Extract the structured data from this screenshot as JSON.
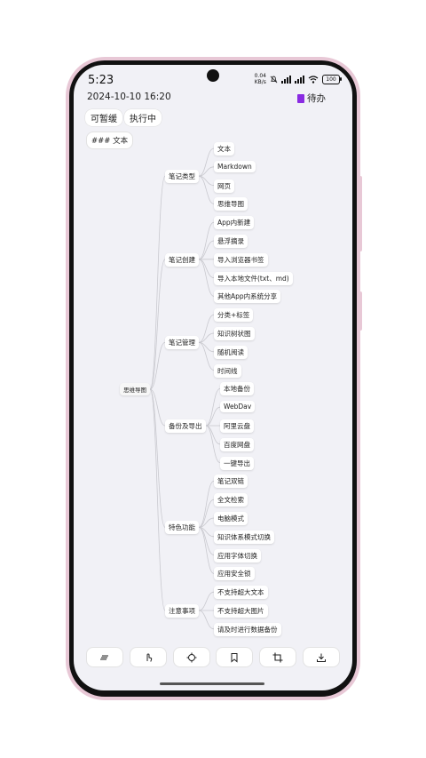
{
  "status": {
    "time": "5:23",
    "speed_value": "0.04",
    "speed_unit": "KB/s",
    "battery": "100"
  },
  "header": {
    "date": "2024-10-10 16:20",
    "todo_label": "待办"
  },
  "chips": [
    "可暂缓",
    "执行中"
  ],
  "tag_chip": "### 文本",
  "mindmap": {
    "root": "思维导图",
    "branches": [
      {
        "label": "笔记类型",
        "children": [
          "文本",
          "Markdown",
          "网页",
          "思维导图"
        ]
      },
      {
        "label": "笔记创建",
        "children": [
          "App内新建",
          "悬浮摘录",
          "导入浏览器书签",
          "导入本地文件(txt、md)",
          "其他App内系统分享"
        ]
      },
      {
        "label": "笔记管理",
        "children": [
          "分类+标签",
          "知识树状图",
          "随机阅读",
          "时间线"
        ]
      },
      {
        "label": "备份及导出",
        "children": [
          "本地备份",
          "WebDav",
          "阿里云盘",
          "百度网盘",
          "一键导出"
        ]
      },
      {
        "label": "特色功能",
        "children": [
          "笔记双链",
          "全文检索",
          "电脑模式",
          "知识体系模式切换",
          "应用字体切换",
          "应用安全锁"
        ]
      },
      {
        "label": "注意事项",
        "children": [
          "不支持超大文本",
          "不支持超大图片",
          "请及时进行数据备份"
        ]
      }
    ]
  },
  "toolbar": {
    "icons": [
      "menu-lines-icon",
      "touch-pointer-icon",
      "crosshair-icon",
      "bookmark-icon",
      "crop-icon",
      "download-icon"
    ]
  }
}
